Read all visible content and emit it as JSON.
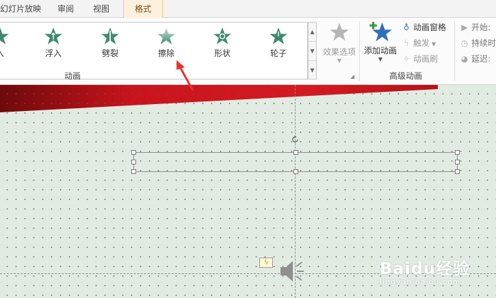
{
  "tabs": [
    "幻灯片放映",
    "审阅",
    "视图",
    "格式"
  ],
  "gallery": {
    "items": [
      "入",
      "浮入",
      "劈裂",
      "擦除",
      "形状",
      "轮子"
    ],
    "group_label": "动画"
  },
  "effect_options": "效果选项",
  "advanced": {
    "add_animation": "添加动画",
    "animation_pane": "动画窗格",
    "trigger": "触发",
    "animation_painter": "动画刷",
    "group_label": "高级动画"
  },
  "timing": {
    "start": "开始:",
    "duration": "持续时",
    "delay": "延迟:"
  },
  "colors": {
    "star": "#3f8a6f",
    "accent_red": "#c8141c",
    "slide_bg": "#e2ebe2",
    "format_tab": "#fdf0dc"
  },
  "watermark": {
    "logo": "Baidu经验",
    "url": "jingyan.baidu.com"
  }
}
